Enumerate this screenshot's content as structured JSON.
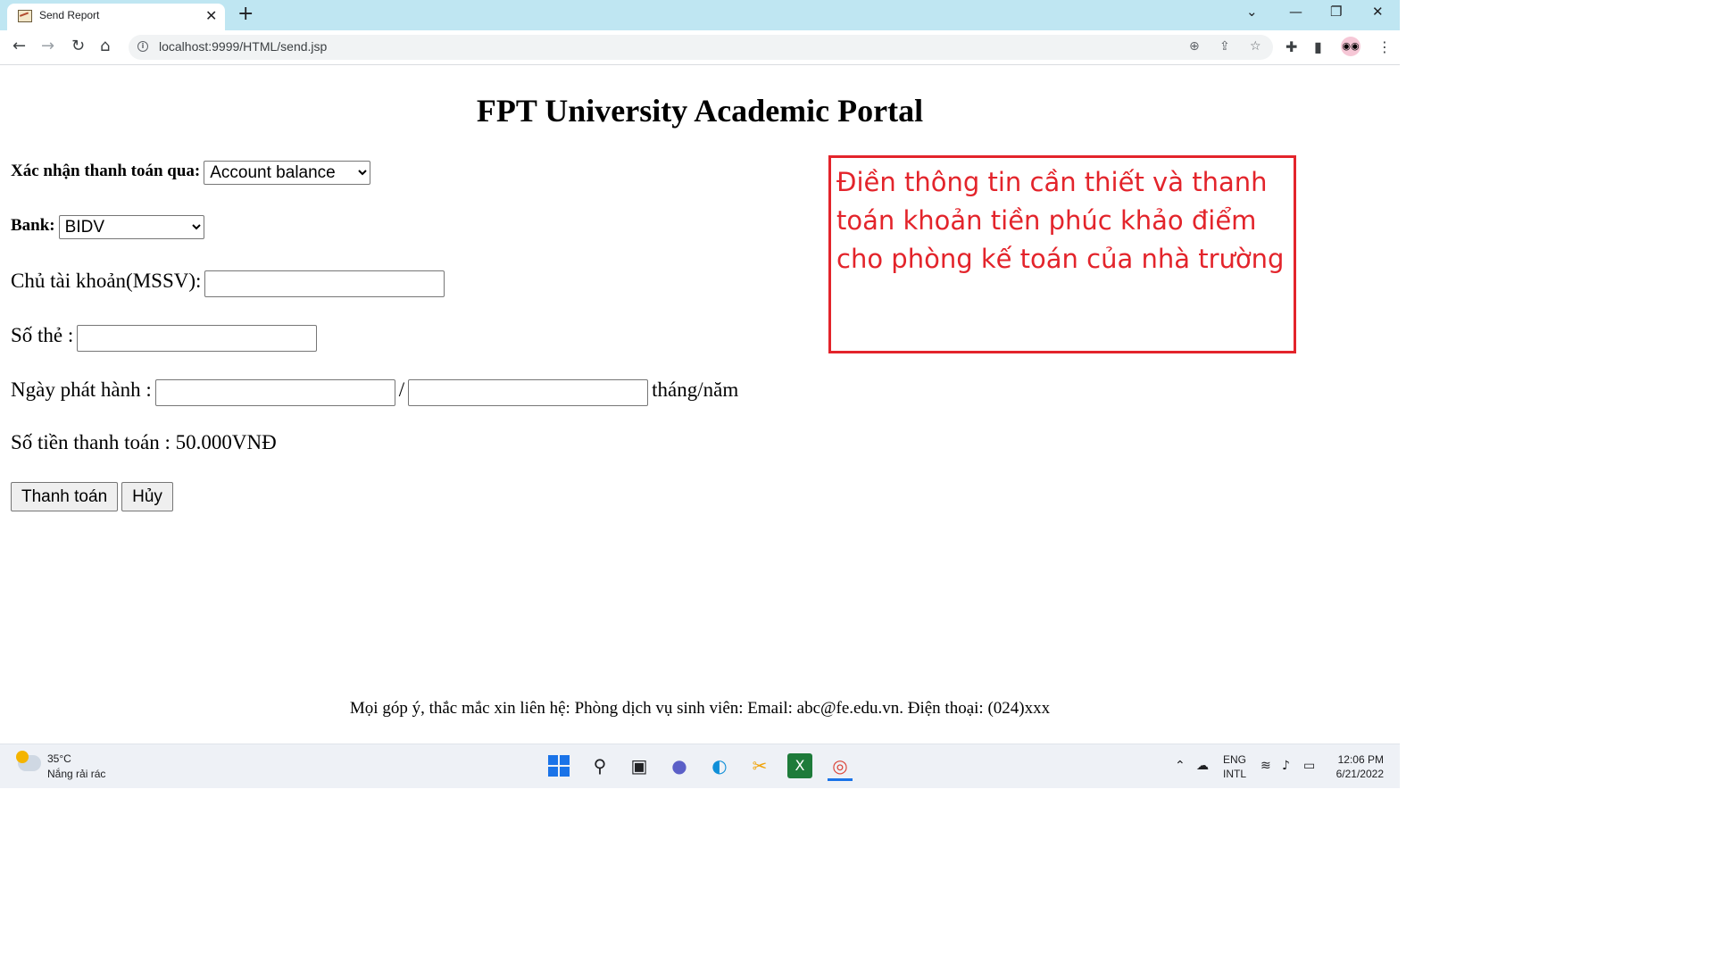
{
  "browser": {
    "tab_title": "Send Report",
    "url": "localhost:9999/HTML/send.jsp"
  },
  "page": {
    "title": "FPT University Academic Portal",
    "payment_method_label": "Xác nhận thanh toán qua:",
    "payment_method_value": "Account balance",
    "bank_label": "Bank:",
    "bank_value": "BIDV",
    "account_owner_label": "Chủ tài khoản(MSSV):",
    "card_number_label": "Số thẻ :",
    "issue_date_label": "Ngày phát hành :",
    "date_separator": "/",
    "date_format_hint": "tháng/năm",
    "amount_text": "Số tiền thanh toán : 50.000VNĐ",
    "pay_button": "Thanh toán",
    "cancel_button": "Hủy",
    "annotation": "Điền thông tin cần thiết và thanh toán khoản tiền phúc khảo điểm cho phòng kế toán của nhà trường",
    "footer": "Mọi góp ý, thắc mắc xin liên hệ: Phòng dịch vụ sinh viên: Email: abc@fe.edu.vn. Điện thoại: (024)xxx"
  },
  "annotation_color": "#e3242b",
  "taskbar": {
    "temperature": "35°C",
    "weather": "Nắng rải rác",
    "lang_line1": "ENG",
    "lang_line2": "INTL",
    "time": "12:06 PM",
    "date": "6/21/2022",
    "apps": [
      "windows-start-icon",
      "search-icon",
      "task-view-icon",
      "chat-icon",
      "edge-icon",
      "snipping-tool-icon",
      "excel-icon",
      "chrome-icon"
    ]
  }
}
